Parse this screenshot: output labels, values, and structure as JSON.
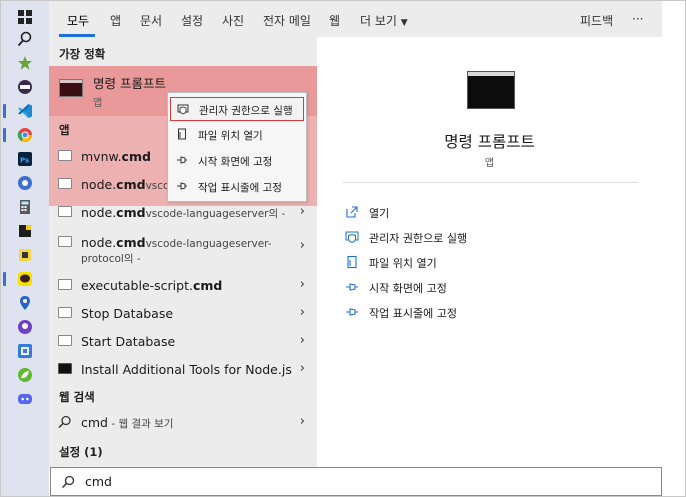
{
  "tabs": {
    "items": [
      "모두",
      "앱",
      "문서",
      "설정",
      "사진",
      "전자 메일",
      "웹",
      "더 보기"
    ],
    "feedback": "피드백",
    "more": "···"
  },
  "sections": {
    "best_match": "가장 정확",
    "apps": "앱",
    "web_search": "웹 검색",
    "settings": "설정 (1)"
  },
  "best_match": {
    "title": "명령 프롬프트",
    "subtitle": "앱"
  },
  "context_menu": [
    "관리자 권한으로 실행",
    "파일 위치 열기",
    "시작 화면에 고정",
    "작업 표시줄에 고정"
  ],
  "results": [
    {
      "plain": "mvnw.",
      "bold": "cmd",
      "sub": ""
    },
    {
      "plain": "node.",
      "bold": "cmd",
      "sub": "vscode-"
    },
    {
      "plain": "node.",
      "bold": "cmd",
      "sub": "vscode-languageserver의 -"
    },
    {
      "plain": "node.",
      "bold": "cmd",
      "sub": "vscode-languageserver-",
      "sub2": "protocol의 -"
    },
    {
      "plain": "executable-script.",
      "bold": "cmd",
      "sub": ""
    },
    {
      "plain": "Stop Database",
      "bold": "",
      "sub": ""
    },
    {
      "plain": "Start Database",
      "bold": "",
      "sub": ""
    },
    {
      "plain": "Install Additional Tools for Node.js",
      "bold": "",
      "sub": ""
    }
  ],
  "web_result": {
    "query": "cmd",
    "suffix": " - 웹 결과 보기"
  },
  "detail": {
    "title": "명령 프롬프트",
    "subtitle": "앱",
    "actions": [
      "열기",
      "관리자 권한으로 실행",
      "파일 위치 열기",
      "시작 화면에 고정",
      "작업 표시줄에 고정"
    ]
  },
  "search": {
    "value": "cmd"
  },
  "colors": {
    "accent": "#1e6fd9",
    "highlight": "#f08282",
    "selection_border": "#d93a3a"
  },
  "taskbar_icons": [
    "windows-start-icon",
    "search-icon",
    "app-green-icon",
    "app-dark-icon",
    "vscode-icon",
    "chrome-icon",
    "photoshop-icon",
    "app-blue-icon",
    "calculator-icon",
    "sticky-notes-icon",
    "app-yellow-icon",
    "kakaotalk-icon",
    "maps-icon",
    "github-icon",
    "app-blue-square-icon",
    "spring-icon",
    "discord-icon"
  ]
}
